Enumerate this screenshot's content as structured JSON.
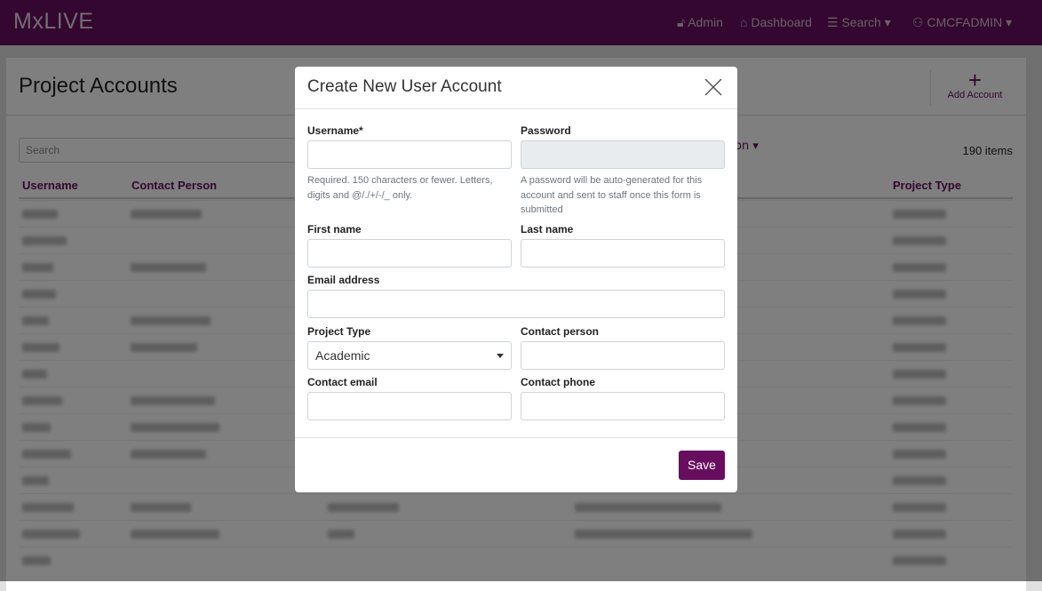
{
  "nav": {
    "brand": "MxLIVE",
    "items": [
      {
        "label": "Admin",
        "icon": "lock-icon"
      },
      {
        "label": "Dashboard",
        "icon": "home-icon"
      },
      {
        "label": "Search",
        "icon": "list-icon"
      },
      {
        "label": "CMCFADMIN",
        "icon": "user-icon"
      }
    ]
  },
  "page": {
    "title": "Project Accounts",
    "add_label": "Add Account",
    "search_placeholder": "Search",
    "count": "190 items",
    "filter_fragment": "on",
    "columns": [
      "Username",
      "Contact Person",
      "Project Type"
    ]
  },
  "modal": {
    "title": "Create New User Account",
    "save": "Save",
    "fields": {
      "username": {
        "label": "Username*",
        "help": "Required. 150 characters or fewer. Letters, digits and @/./+/-/_ only."
      },
      "password": {
        "label": "Password",
        "help": "A password will be auto-generated for this account and sent to staff once this form is submitted"
      },
      "first_name": {
        "label": "First name"
      },
      "last_name": {
        "label": "Last name"
      },
      "email": {
        "label": "Email address"
      },
      "project_type": {
        "label": "Project Type",
        "value": "Academic"
      },
      "contact_person": {
        "label": "Contact person"
      },
      "contact_email": {
        "label": "Contact email"
      },
      "contact_phone": {
        "label": "Contact phone"
      }
    }
  },
  "colors": {
    "brand": "#670e5f"
  }
}
